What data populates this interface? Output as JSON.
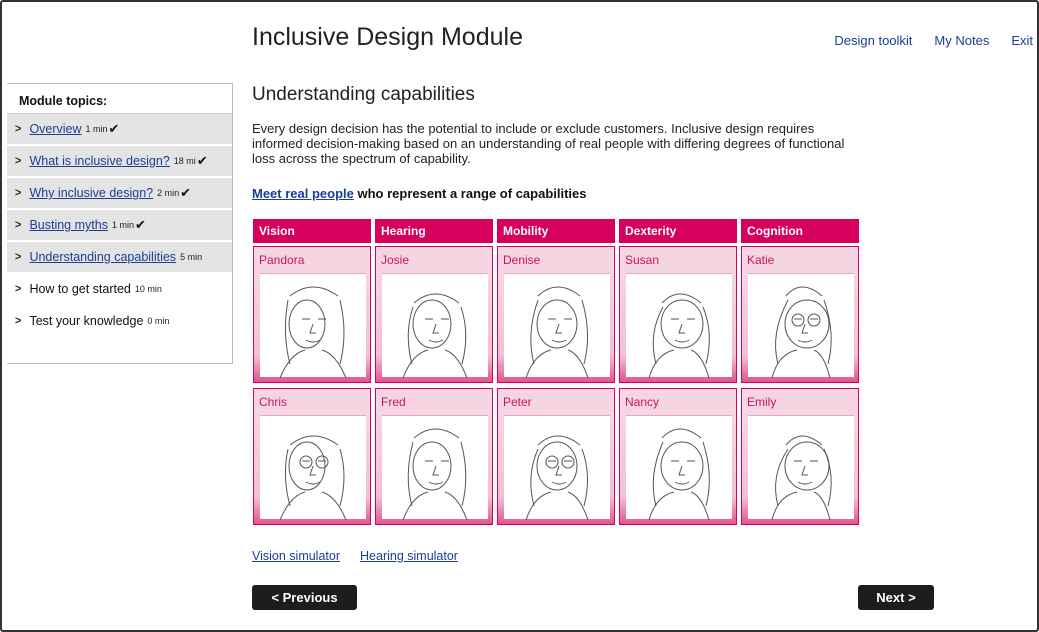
{
  "header": {
    "title": "Inclusive Design Module",
    "nav": [
      "Design toolkit",
      "My Notes",
      "Exit"
    ]
  },
  "sidebar": {
    "heading": "Module topics:",
    "items": [
      {
        "label": "Overview",
        "minutes": "1 min",
        "completed": true,
        "link": true
      },
      {
        "label": "What is inclusive design?",
        "minutes": "18 mi",
        "completed": true,
        "link": true
      },
      {
        "label": "Why inclusive design?",
        "minutes": "2 min",
        "completed": true,
        "link": true
      },
      {
        "label": "Busting myths",
        "minutes": "1 min",
        "completed": true,
        "link": true
      },
      {
        "label": "Understanding capabilities",
        "minutes": "5 min",
        "completed": false,
        "link": true
      },
      {
        "label": "How to get started",
        "minutes": "10 min",
        "completed": false,
        "link": false
      },
      {
        "label": "Test your knowledge",
        "minutes": "0 min",
        "completed": false,
        "link": false
      }
    ],
    "arrow_glyph": ">",
    "tick_glyph": "✔"
  },
  "main": {
    "title": "Understanding capabilities",
    "intro": "Every design decision has the potential to include or exclude customers. Inclusive design requires informed decision-making based on an understanding of real people with differing degrees of functional loss across the spectrum of capability.",
    "meet_link": "Meet real people",
    "meet_rest": " who represent a range of capabilities",
    "categories": [
      "Vision",
      "Hearing",
      "Mobility",
      "Dexterity",
      "Cognition"
    ],
    "people_rows": [
      [
        "Pandora",
        "Josie",
        "Denise",
        "Susan",
        "Katie"
      ],
      [
        "Chris",
        "Fred",
        "Peter",
        "Nancy",
        "Emily"
      ]
    ],
    "simulators": [
      "Vision simulator",
      "Hearing simulator"
    ],
    "prev_label": "< Previous",
    "next_label": "Next >"
  },
  "colors": {
    "accent": "#d6005f",
    "link": "#1a3d96",
    "button": "#1d1d1d",
    "completed_bg": "#e4e4e4"
  }
}
